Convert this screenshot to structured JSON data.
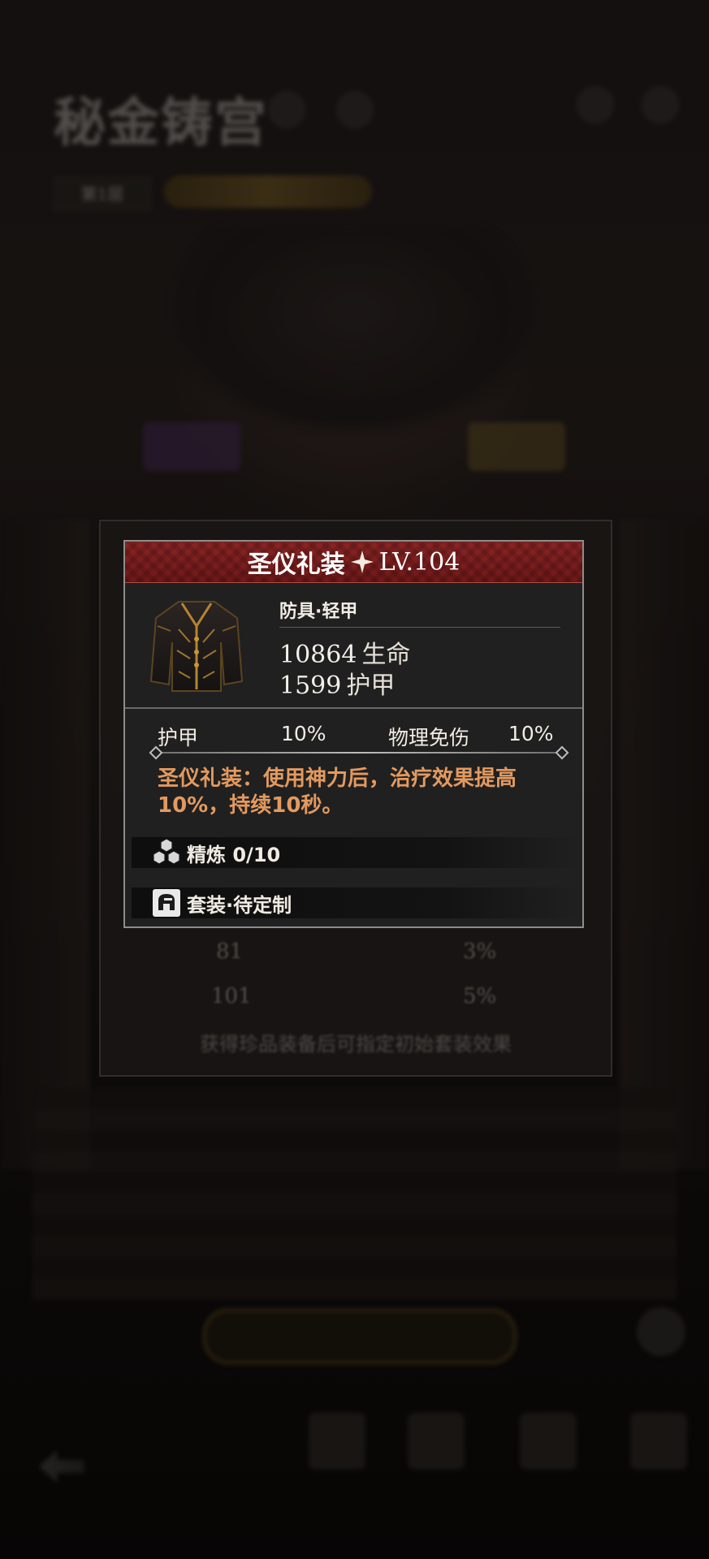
{
  "background": {
    "title": "秘金铸宫",
    "floor_label": "第1层",
    "lower_panel": {
      "rows": [
        {
          "level": "81",
          "value": "3%"
        },
        {
          "level": "101",
          "value": "5%"
        }
      ],
      "note": "获得珍品装备后可指定初始套装效果"
    }
  },
  "item": {
    "name": "圣仪礼装",
    "level": "LV.104",
    "type": "防具·轻甲",
    "main_stats": [
      {
        "value": "10864",
        "label": "生命"
      },
      {
        "value": "1599",
        "label": "护甲"
      }
    ],
    "sub_stats": [
      {
        "label": "护甲",
        "value": "10%"
      },
      {
        "label": "物理免伤",
        "value": "10%"
      }
    ],
    "effect_text": "圣仪礼装：使用神力后，治疗效果提高10%，持续10秒。",
    "refine_label": "精炼 0/10",
    "set_label": "套装·待定制"
  },
  "colors": {
    "header_red": "#7c1d1d",
    "effect_orange": "#e39a5f",
    "panel_bg": "#202020",
    "border": "#8d8d8d"
  }
}
